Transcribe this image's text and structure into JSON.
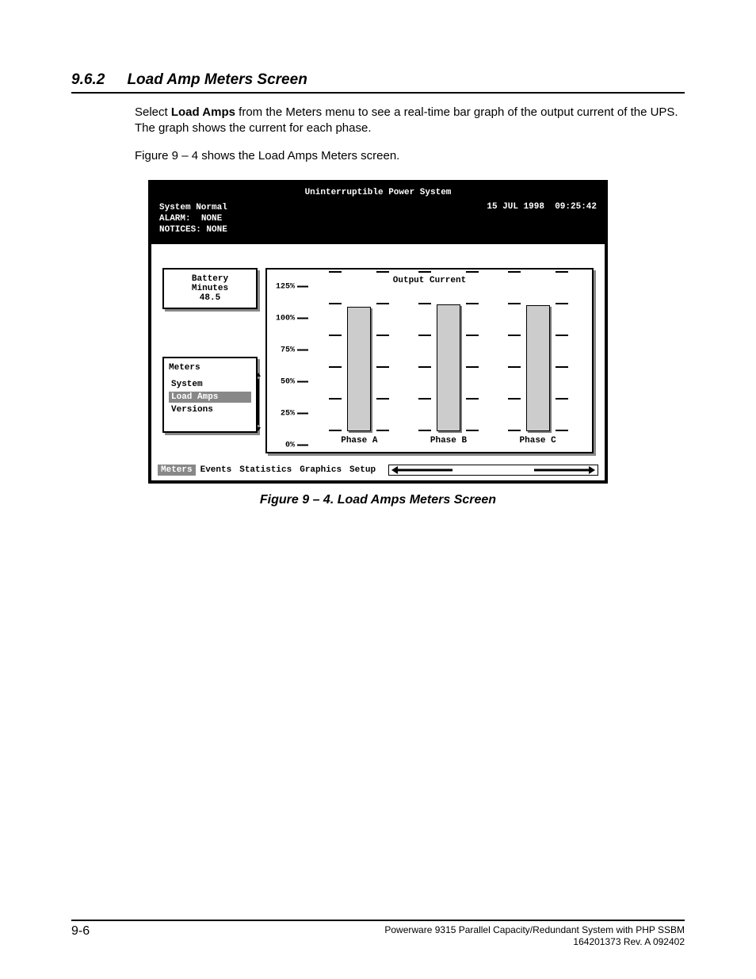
{
  "section": {
    "number": "9.6.2",
    "title": "Load Amp Meters Screen"
  },
  "paragraphs": {
    "p1_a": "Select ",
    "p1_bold": "Load Amps",
    "p1_b": " from the Meters menu to see a real-time bar graph of the output current of the UPS.  The graph shows the current for each phase.",
    "p2": "Figure 9 – 4 shows the Load Amps Meters screen."
  },
  "ups": {
    "app_title": "Uninterruptible Power System",
    "status": "System Normal",
    "alarm_label": "ALARM:",
    "alarm_value": "NONE",
    "notices": "NOTICES: NONE",
    "date": "15 JUL 1998",
    "time": "09:25:42",
    "battery": {
      "l1": "Battery",
      "l2": "Minutes",
      "l3": "48.5"
    },
    "meters_panel": {
      "title": "Meters",
      "items": [
        "System",
        "Load Amps",
        "Versions"
      ],
      "active_index": 1
    },
    "footer_menu": {
      "items": [
        "Meters",
        "Events",
        "Statistics",
        "Graphics",
        "Setup"
      ],
      "active_index": 0
    }
  },
  "chart_data": {
    "type": "bar",
    "title": "Output Current",
    "categories": [
      "Phase A",
      "Phase B",
      "Phase C"
    ],
    "values": [
      98,
      100,
      99
    ],
    "ylabel": "",
    "ylim": [
      0,
      125
    ],
    "yticks": [
      "125%",
      "100%",
      "75%",
      "50%",
      "25%",
      "0%"
    ]
  },
  "figure_caption": "Figure 9 – 4.    Load Amps Meters Screen",
  "footer": {
    "page_num": "9-6",
    "line1": "Powerware 9315 Parallel Capacity/Redundant System with PHP SSBM",
    "line2": "164201373   Rev. A     092402"
  }
}
